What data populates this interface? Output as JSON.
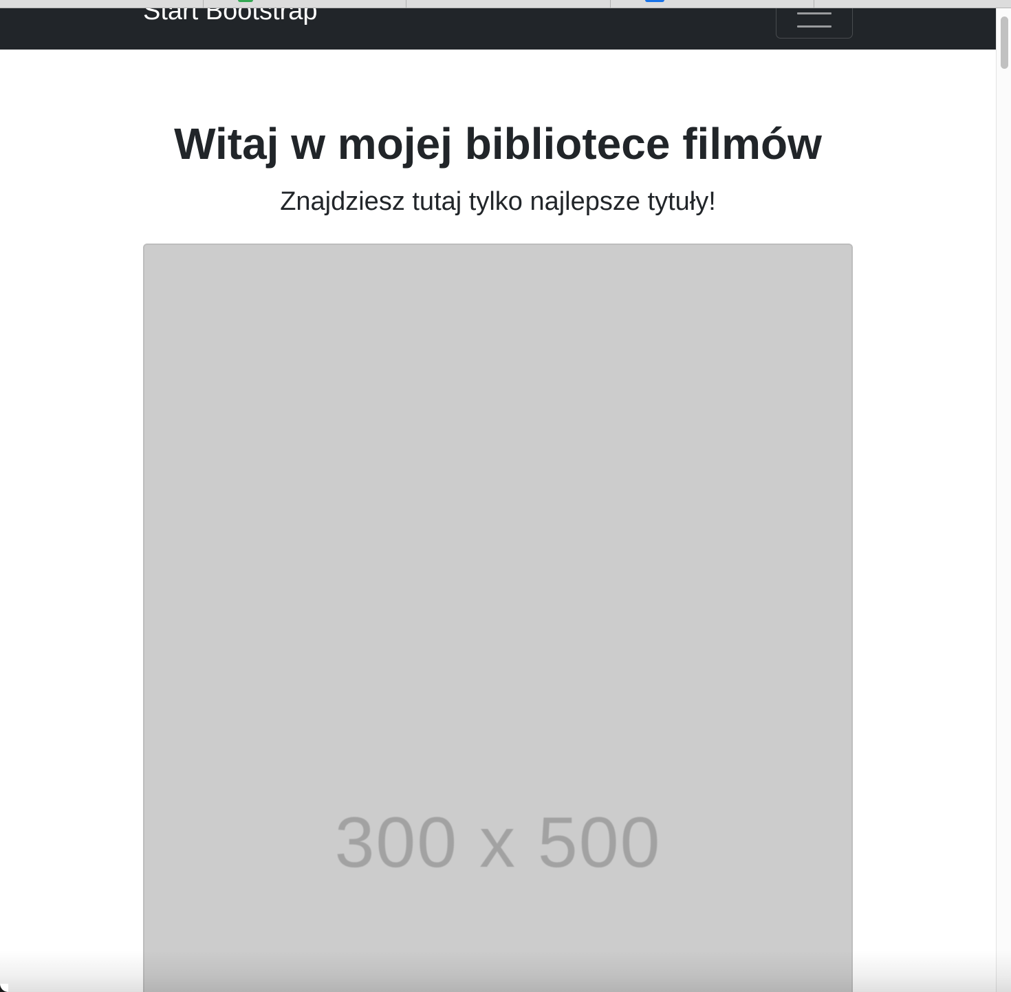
{
  "navbar": {
    "brand": "Start Bootstrap",
    "toggler_icon": "hamburger-menu-icon"
  },
  "hero": {
    "title": "Witaj w mojej bibliotece filmów",
    "lead": "Znajdziesz tutaj tylko najlepsze tytuły!"
  },
  "placeholder_image": {
    "label": "300 x 500"
  },
  "colors": {
    "navbar_bg": "#212529",
    "text": "#212529",
    "placeholder_bg": "#cccccc",
    "placeholder_text": "#a2a2a2"
  }
}
